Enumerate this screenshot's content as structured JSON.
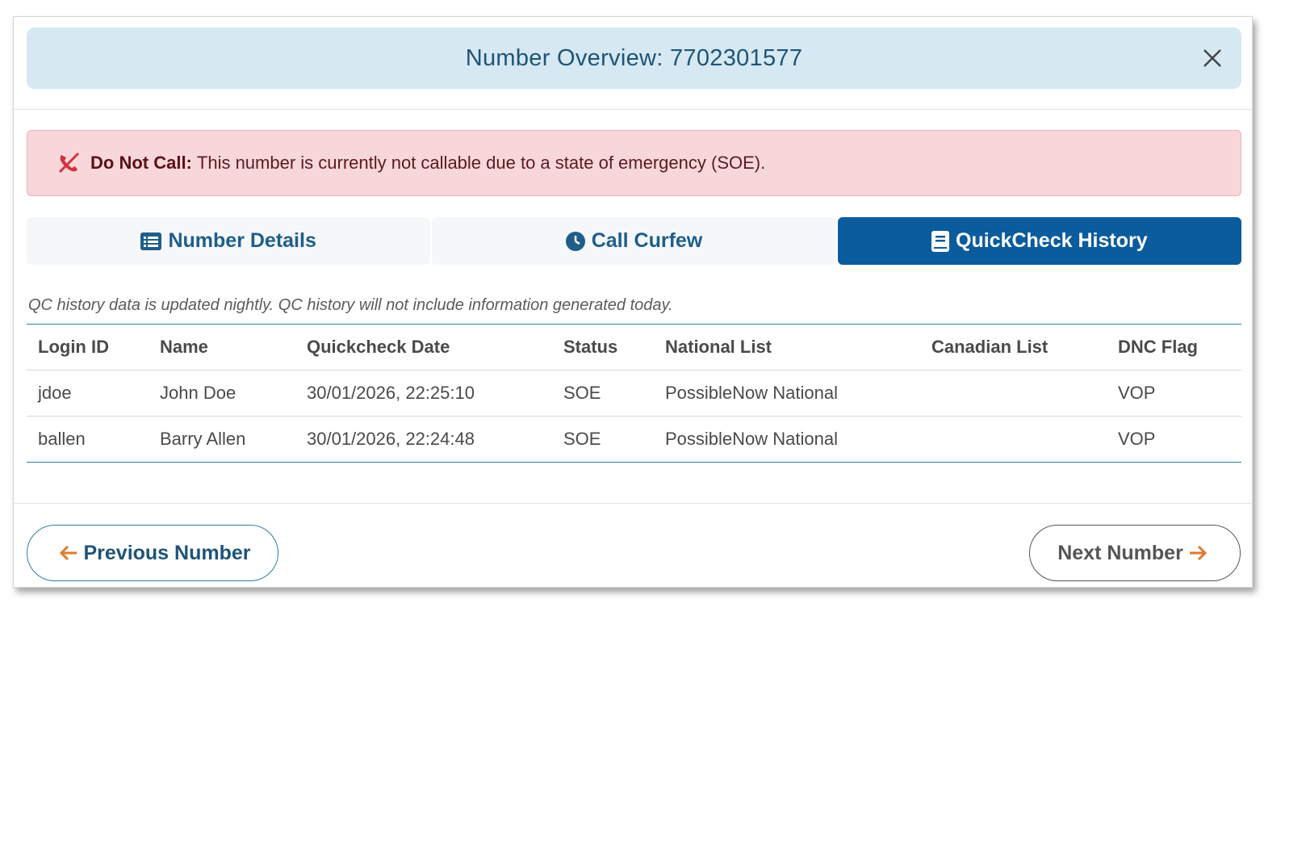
{
  "header": {
    "title": "Number Overview: 7702301577"
  },
  "alert": {
    "strong": "Do Not Call:",
    "message": "This number is currently not callable due to a state of emergency (SOE)."
  },
  "tabs": [
    {
      "label": "Number Details",
      "icon": "list-icon",
      "active": false
    },
    {
      "label": "Call Curfew",
      "icon": "clock-icon",
      "active": false
    },
    {
      "label": "QuickCheck History",
      "icon": "book-icon",
      "active": true
    }
  ],
  "note": "QC history data is updated nightly. QC history will not include information generated today.",
  "table": {
    "columns": [
      "Login ID",
      "Name",
      "Quickcheck Date",
      "Status",
      "National List",
      "Canadian List",
      "DNC Flag"
    ],
    "rows": [
      [
        "jdoe",
        "John Doe",
        "30/01/2026, 22:25:10",
        "SOE",
        "PossibleNow National",
        "",
        "VOP"
      ],
      [
        "ballen",
        "Barry Allen",
        "30/01/2026, 22:24:48",
        "SOE",
        "PossibleNow National",
        "",
        "VOP"
      ]
    ]
  },
  "footer": {
    "prev_label": "Previous Number",
    "next_label": "Next Number"
  },
  "colors": {
    "header_bg": "#d6e8f1",
    "title": "#1e5478",
    "alert_bg": "#f8d7da",
    "alert_icon": "#d0333f",
    "tab_active": "#0b5c9c",
    "arrow": "#e07a2e"
  }
}
